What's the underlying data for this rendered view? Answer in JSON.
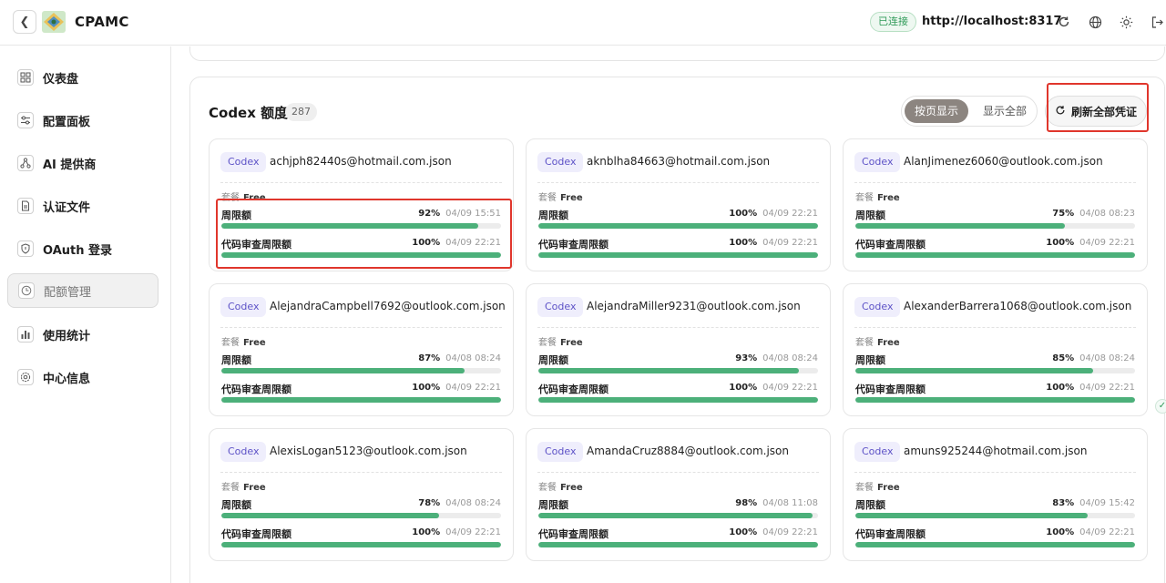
{
  "header": {
    "brand": "CPAMC",
    "status": "已连接",
    "server_url": "http://localhost:8317"
  },
  "sidebar": {
    "items": [
      {
        "label": "仪表盘",
        "icon": "dashboard-icon"
      },
      {
        "label": "配置面板",
        "icon": "sliders-icon"
      },
      {
        "label": "AI 提供商",
        "icon": "ai-provider-icon"
      },
      {
        "label": "认证文件",
        "icon": "file-icon"
      },
      {
        "label": "OAuth 登录",
        "icon": "shield-icon"
      },
      {
        "label": "配额管理",
        "icon": "quota-icon",
        "active": true
      },
      {
        "label": "使用统计",
        "icon": "bar-chart-icon"
      },
      {
        "label": "中心信息",
        "icon": "info-gear-icon"
      }
    ]
  },
  "panel": {
    "title": "Codex 额度",
    "count": "287",
    "toggle_paged": "按页显示",
    "toggle_all": "显示全部",
    "refresh_label": "刷新全部凭证"
  },
  "labels": {
    "tag": "Codex",
    "plan_label": "套餐",
    "weekly": "周限额",
    "review": "代码审查周限额"
  },
  "cards": [
    {
      "file": "achjph82440s@hotmail.com.json",
      "plan": "Free",
      "weekly_pct": "92%",
      "weekly_value": 92,
      "weekly_time": "04/09 15:51",
      "review_pct": "100%",
      "review_value": 100,
      "review_time": "04/09 22:21"
    },
    {
      "file": "aknblha84663@hotmail.com.json",
      "plan": "Free",
      "weekly_pct": "100%",
      "weekly_value": 100,
      "weekly_time": "04/09 22:21",
      "review_pct": "100%",
      "review_value": 100,
      "review_time": "04/09 22:21"
    },
    {
      "file": "AlanJimenez6060@outlook.com.json",
      "plan": "Free",
      "weekly_pct": "75%",
      "weekly_value": 75,
      "weekly_time": "04/08 08:23",
      "review_pct": "100%",
      "review_value": 100,
      "review_time": "04/09 22:21"
    },
    {
      "file": "AlejandraCampbell7692@outlook.com.json",
      "plan": "Free",
      "weekly_pct": "87%",
      "weekly_value": 87,
      "weekly_time": "04/08 08:24",
      "review_pct": "100%",
      "review_value": 100,
      "review_time": "04/09 22:21"
    },
    {
      "file": "AlejandraMiller9231@outlook.com.json",
      "plan": "Free",
      "weekly_pct": "93%",
      "weekly_value": 93,
      "weekly_time": "04/08 08:24",
      "review_pct": "100%",
      "review_value": 100,
      "review_time": "04/09 22:21"
    },
    {
      "file": "AlexanderBarrera1068@outlook.com.json",
      "plan": "Free",
      "weekly_pct": "85%",
      "weekly_value": 85,
      "weekly_time": "04/08 08:24",
      "review_pct": "100%",
      "review_value": 100,
      "review_time": "04/09 22:21"
    },
    {
      "file": "AlexisLogan5123@outlook.com.json",
      "plan": "Free",
      "weekly_pct": "78%",
      "weekly_value": 78,
      "weekly_time": "04/08 08:24",
      "review_pct": "100%",
      "review_value": 100,
      "review_time": "04/09 22:21"
    },
    {
      "file": "AmandaCruz8884@outlook.com.json",
      "plan": "Free",
      "weekly_pct": "98%",
      "weekly_value": 98,
      "weekly_time": "04/08 11:08",
      "review_pct": "100%",
      "review_value": 100,
      "review_time": "04/09 22:21"
    },
    {
      "file": "amuns925244@hotmail.com.json",
      "plan": "Free",
      "weekly_pct": "83%",
      "weekly_value": 83,
      "weekly_time": "04/09 15:42",
      "review_pct": "100%",
      "review_value": 100,
      "review_time": "04/09 22:21"
    }
  ],
  "colors": {
    "accent_green": "#4cb07a",
    "highlight_red": "#e0362c",
    "tag_purple": "#5d52c7"
  }
}
